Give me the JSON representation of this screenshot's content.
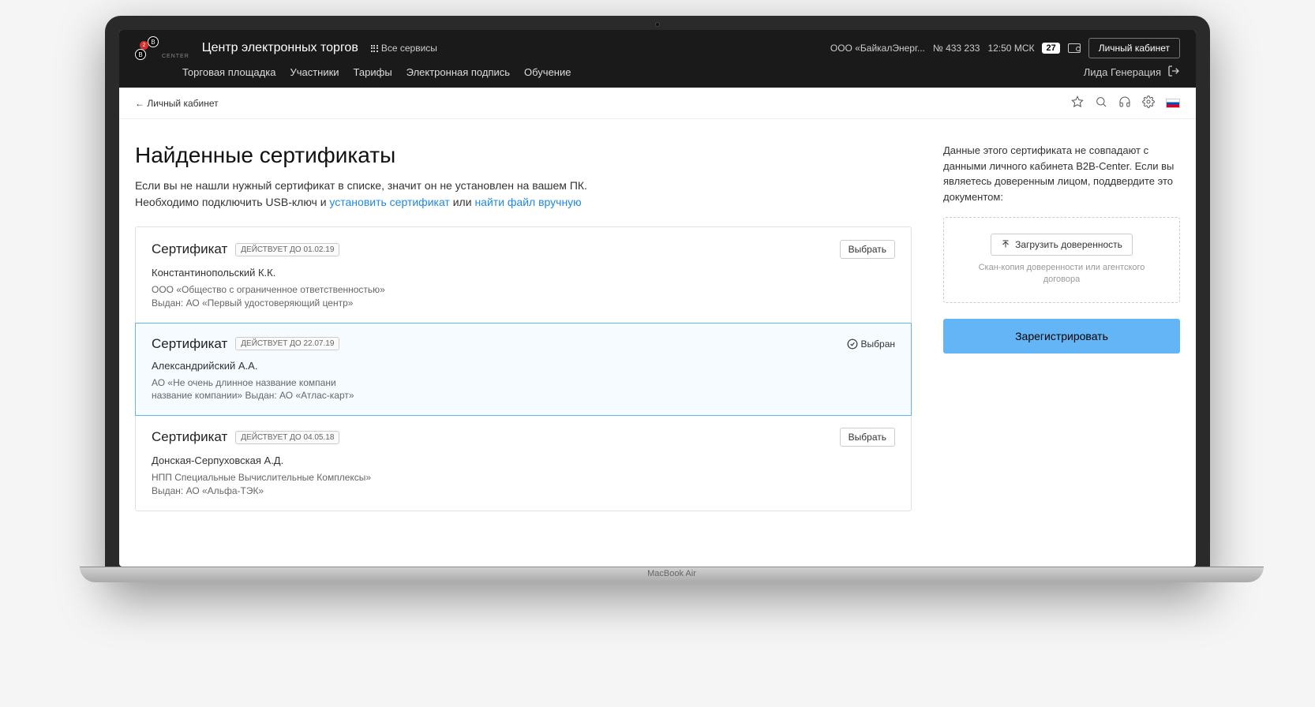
{
  "header": {
    "brand": "Центр электронных торгов",
    "all_services": "Все сервисы",
    "org": "ООО «БайкалЭнерг...",
    "order_no": "№ 433 233",
    "time": "12:50 МСК",
    "count": "27",
    "account_btn": "Личный кабинет",
    "logo_sub": "CENTER",
    "logo_badge": "2",
    "logo_letter": "B"
  },
  "nav": {
    "items": [
      "Торговая площадка",
      "Участники",
      "Тарифы",
      "Электронная подпись",
      "Обучение"
    ],
    "user": "Лида Генерация"
  },
  "subbar": {
    "back": "← Личный кабинет"
  },
  "page": {
    "title": "Найденные сертификаты",
    "intro1": "Если вы не нашли нужный сертификат в списке, значит он не установлен на вашем ПК.",
    "intro2a": "Необходимо подключить USB-ключ и ",
    "link1": "установить сертификат",
    "intro2b": " или ",
    "link2": "найти файл вручную"
  },
  "certs": [
    {
      "title": "Сертификат",
      "badge": "ДЕЙСТВУЕТ ДО 01.02.19",
      "action": "Выбрать",
      "selected": false,
      "person": "Константинопольский К.К.",
      "meta1": "ООО «Общество с ограниченное ответственностью»",
      "meta2": "Выдан: АО «Первый удостоверяющий центр»"
    },
    {
      "title": "Сертификат",
      "badge": "ДЕЙСТВУЕТ ДО 22.07.19",
      "action": "Выбран",
      "selected": true,
      "person": "Александрийский А.А.",
      "meta1": "АО «Не очень длинное название компани",
      "meta2": "название компании» Выдан:  АО «Атлас-карт»"
    },
    {
      "title": "Сертификат",
      "badge": "ДЕЙСТВУЕТ ДО 04.05.18",
      "action": "Выбрать",
      "selected": false,
      "person": "Донская-Серпуховская А.Д.",
      "meta1": "НПП Специальные Вычислительные Комплексы»",
      "meta2": "Выдан:  АО «Альфа-ТЭК»"
    }
  ],
  "side": {
    "text": "Данные этого сертификата не совпадают с данными личного кабинета B2B-Center. Если вы являетесь доверенным лицом, поддвердите это документом:",
    "upload_btn": "Загрузить доверенность",
    "upload_hint": "Скан-копия доверенности или агентского договора",
    "register": "Зарегистрировать"
  },
  "laptop": {
    "brand": "MacBook Air"
  }
}
